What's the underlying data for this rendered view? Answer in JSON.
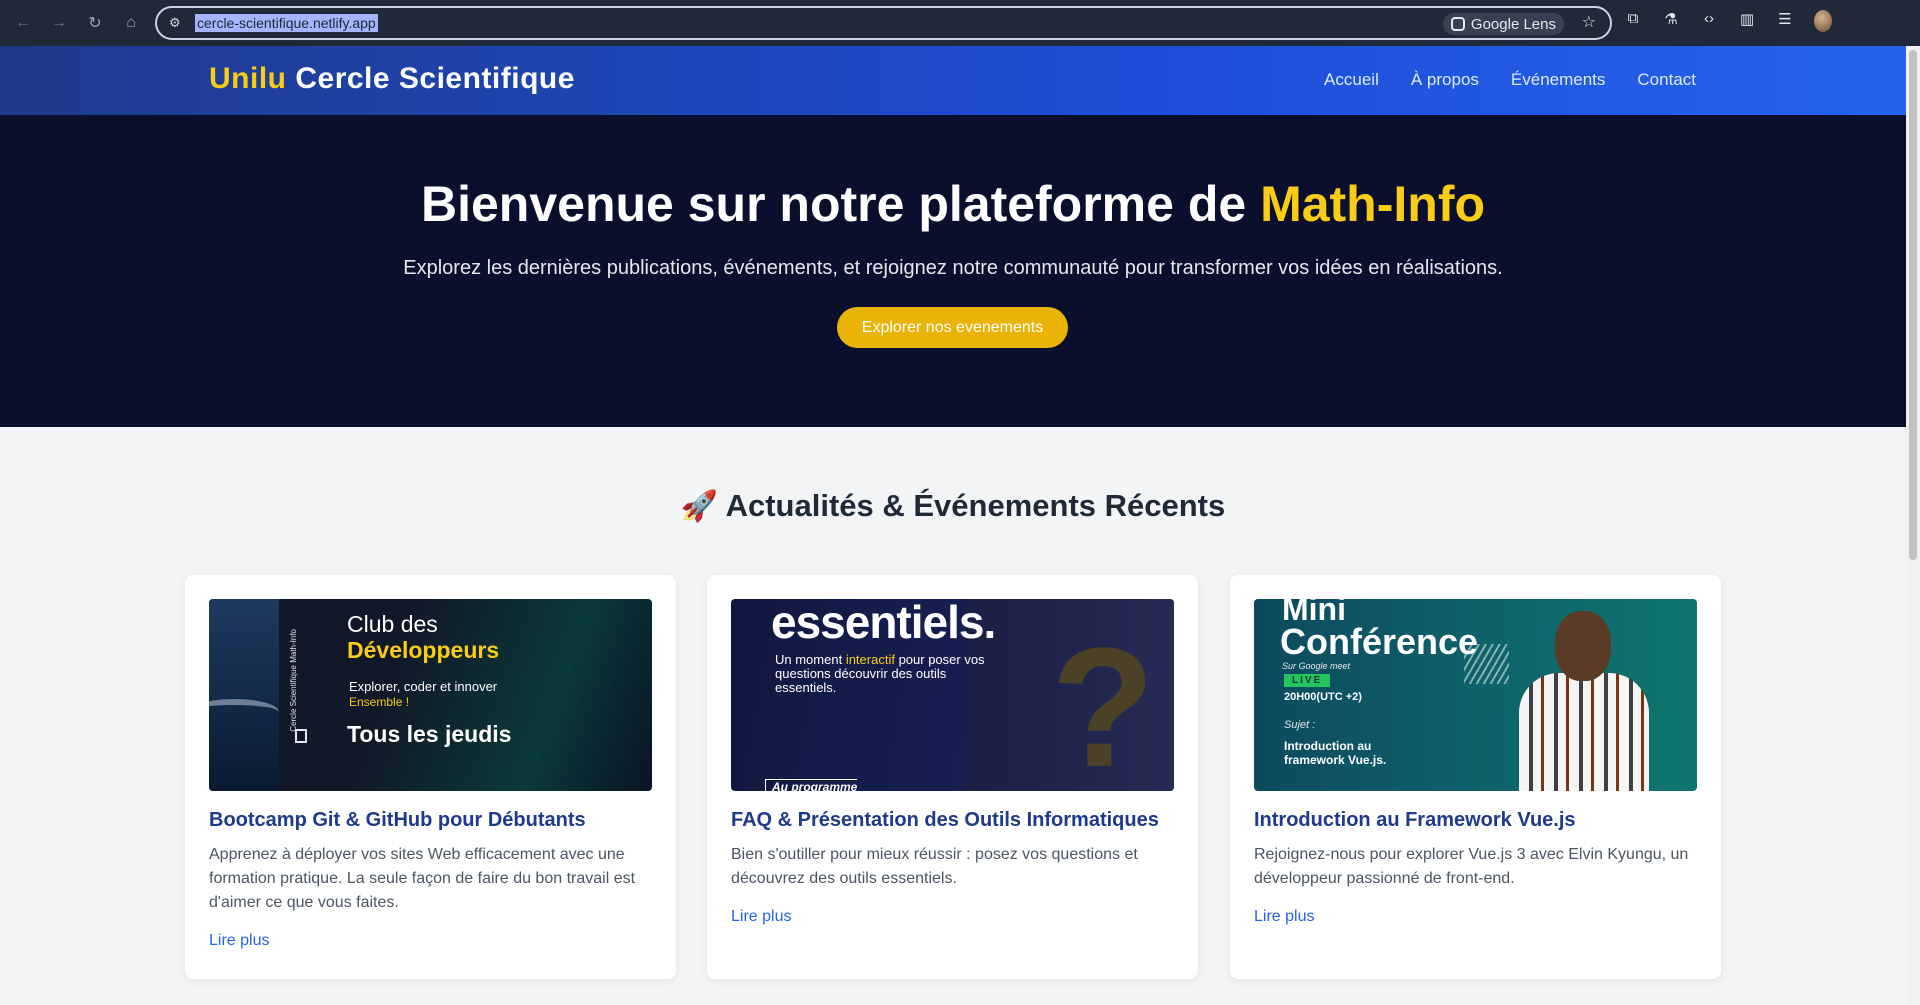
{
  "browser": {
    "url": "cercle-scientifique.netlify.app",
    "lens_label": "Google Lens"
  },
  "site": {
    "brand_highlight": "Unilu",
    "brand_rest": "Cercle Scientifique",
    "nav": [
      "Accueil",
      "À propos",
      "Événements",
      "Contact"
    ]
  },
  "hero": {
    "title_main": "Bienvenue sur notre plateforme de ",
    "title_highlight": "Math-Info",
    "subtitle": "Explorez les dernières publications, événements, et rejoignez notre communauté pour transformer vos idées en réalisations.",
    "cta": "Explorer nos evenements"
  },
  "news": {
    "heading_icon": "🚀",
    "heading": "Actualités & Événements Récents",
    "cards": [
      {
        "title": "Bootcamp Git & GitHub pour Débutants",
        "description": "Apprenez à déployer vos sites Web efficacement avec une formation pratique. La seule façon de faire du bon travail est d'aimer ce que vous faites.",
        "link": "Lire plus",
        "image": {
          "vertical": "Cercle Scientifique Math-Info",
          "line1": "Club des",
          "line2": "Développeurs",
          "line3": "Explorer, coder et innover",
          "line4": "Ensemble !",
          "line5": "Tous les jeudis"
        }
      },
      {
        "title": "FAQ & Présentation des Outils Informatiques",
        "description": "Bien s'outiller pour mieux réussir : posez vos questions et découvrez des outils essentiels.",
        "link": "Lire plus",
        "image": {
          "big": "essentiels.",
          "sub_a": "Un moment ",
          "sub_b": "interactif",
          "sub_c": " pour poser vos questions découvrir des outils essentiels.",
          "mark": "?",
          "program": "Au programme"
        }
      },
      {
        "title": "Introduction au Framework Vue.js",
        "description": "Rejoignez-nous pour explorer Vue.js 3 avec Elvin Kyungu, un développeur passionné de front-end.",
        "link": "Lire plus",
        "image": {
          "mini": "Mini",
          "conf": "Conférence",
          "platform": "Sur Google meet",
          "live": "LIVE",
          "time": "20H00(UTC +2)",
          "sujet": "Sujet :",
          "topic": "Introduction au framework Vue.js."
        }
      }
    ]
  }
}
